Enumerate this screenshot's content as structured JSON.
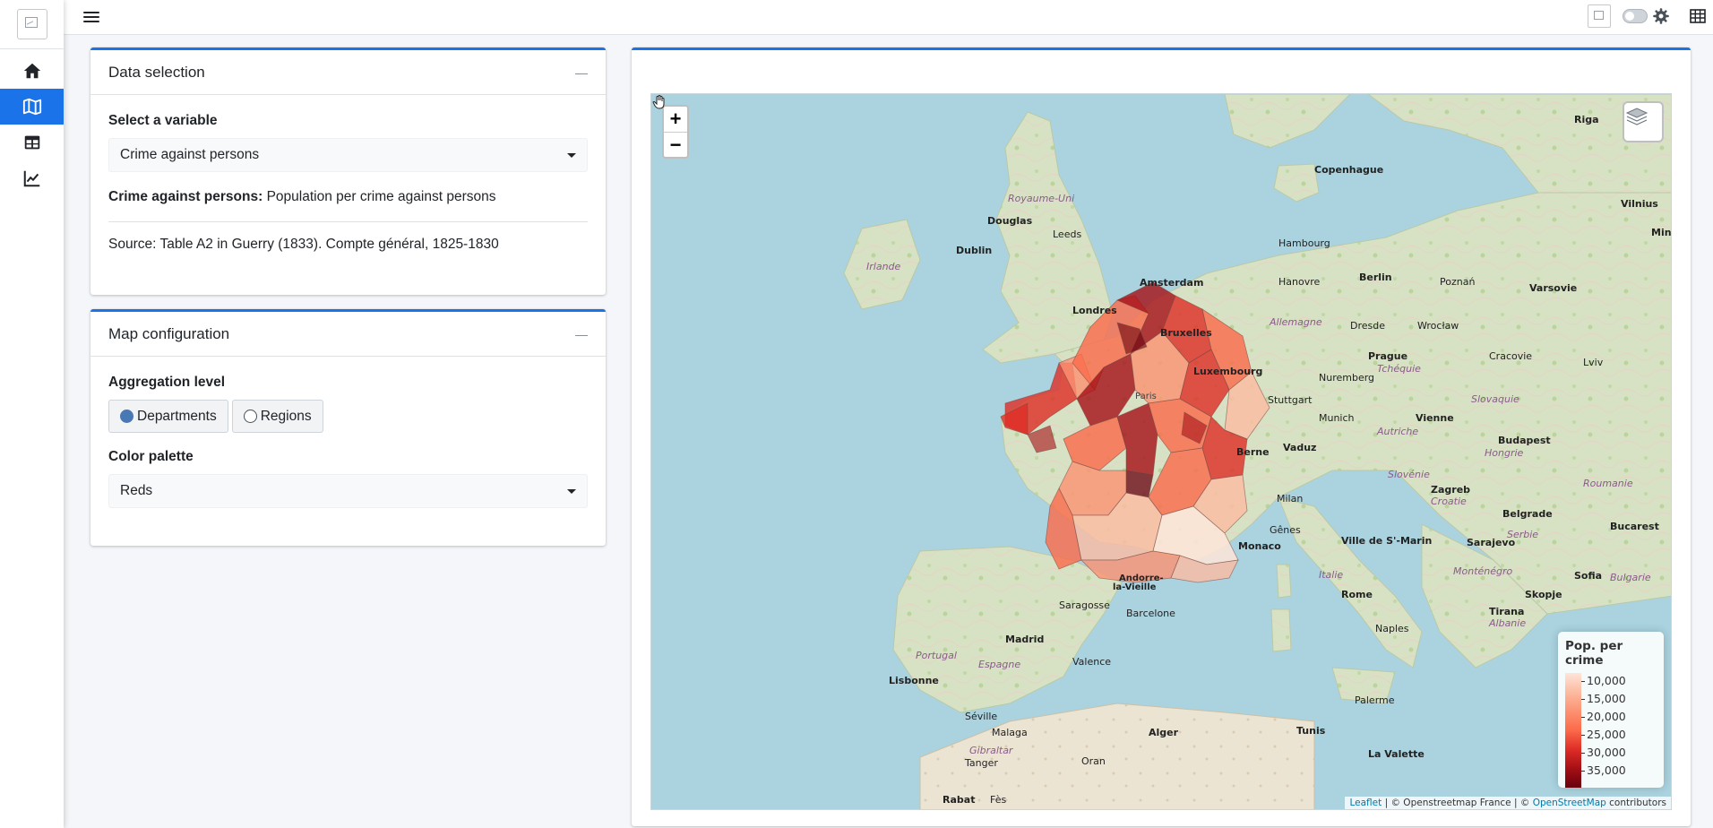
{
  "sidebar": {
    "items": [
      {
        "icon": "home-icon",
        "active": false
      },
      {
        "icon": "map-icon",
        "active": true
      },
      {
        "icon": "table-icon",
        "active": false
      },
      {
        "icon": "chart-line-icon",
        "active": false
      }
    ]
  },
  "header": {
    "icons": [
      "menu-icon",
      "image-icon",
      "theme-toggle",
      "gear-icon",
      "grid-icon"
    ]
  },
  "data_selection": {
    "title": "Data selection",
    "variable_label": "Select a variable",
    "variable_value": "Crime against persons",
    "description_bold": "Crime against persons:",
    "description_text": " Population per crime against persons",
    "source": "Source: Table A2 in Guerry (1833). Compte général, 1825-1830"
  },
  "map_configuration": {
    "title": "Map configuration",
    "aggregation_label": "Aggregation level",
    "options": [
      {
        "label": "Departments",
        "selected": true
      },
      {
        "label": "Regions",
        "selected": false
      }
    ],
    "palette_label": "Color palette",
    "palette_value": "Reds"
  },
  "map": {
    "zoom_in": "+",
    "zoom_out": "−",
    "legend": {
      "title": "Pop. per crime",
      "ticks": [
        "10,000",
        "15,000",
        "20,000",
        "25,000",
        "30,000",
        "35,000"
      ]
    },
    "attribution": {
      "leaflet": "Leaflet",
      "sep1": " | © Openstreetmap France | © ",
      "osm": "OpenStreetMap",
      "tail": " contributors"
    },
    "places": {
      "copenhague": "Copenhague",
      "riga": "Riga",
      "vilnius": "Vilnius",
      "minsk": "Mins",
      "douglas": "Douglas",
      "dublin": "Dublin",
      "irlande": "Irlande",
      "royaume_uni": "Royaume-Uni",
      "leeds": "Leeds",
      "londres": "Londres",
      "amsterdam": "Amsterdam",
      "hambourg": "Hambourg",
      "hanovre": "Hanovre",
      "berlin": "Berlin",
      "poznan": "Poznań",
      "varsovie": "Varsovie",
      "bruxelles": "Bruxelles",
      "luxembourg": "Luxembourg",
      "prague": "Prague",
      "dresde": "Dresde",
      "wroclaw": "Wrocław",
      "cracovie": "Cracovie",
      "lviv": "Lviv",
      "stuttgart": "Stuttgart",
      "nuremberg": "Nuremberg",
      "munich": "Munich",
      "vienne": "Vienne",
      "budapest": "Budapest",
      "berne": "Berne",
      "vaduz": "Vaduz",
      "zagreb": "Zagreb",
      "milan": "Milan",
      "genes": "Gênes",
      "monaco": "Monaco",
      "ville_saint_marin": "Ville de S'-Marin",
      "belgrade": "Belgrade",
      "bucarest": "Bucarest",
      "sarajevo": "Sarajevo",
      "sofia": "Sofia",
      "skopje": "Skopje",
      "rome": "Rome",
      "tirana": "Tirana",
      "naples": "Naples",
      "andorre": "Andorre-",
      "la_vieille": "la-Vieille",
      "saragosse": "Saragosse",
      "barcelone": "Barcelone",
      "madrid": "Madrid",
      "espagne": "Espagne",
      "portugal": "Portugal",
      "lisbonne": "Lisbonne",
      "valence": "Valence",
      "seville": "Séville",
      "malaga": "Malaga",
      "gibraltar": "Gibraltar",
      "tanger": "Tanger",
      "oran": "Oran",
      "alger": "Alger",
      "tunis": "Tunis",
      "la_valette": "La Valette",
      "rabat": "Rabat",
      "fes": "Fès",
      "palerme": "Palerme",
      "paris": "Paris",
      "hongrie": "Hongrie",
      "roumanie": "Roumanie",
      "italie": "Italie",
      "croatie": "Croatie",
      "serbie": "Serbie",
      "bulgarie": "Bulgarie",
      "slovaquie": "Slovaquie",
      "tcheque": "Tchéquie",
      "autriche": "Autriche",
      "allemagne": "Allemagne",
      "slovenie": "Slovénie",
      "montenegro": "Monténégro",
      "albanie": "Albanie"
    }
  }
}
